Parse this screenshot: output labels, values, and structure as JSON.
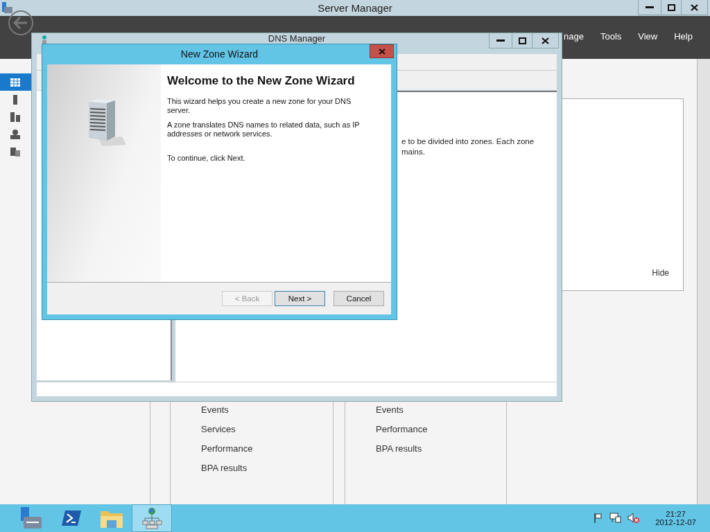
{
  "server_manager": {
    "title": "Server Manager",
    "menu": [
      "nage",
      "Tools",
      "View",
      "Help"
    ],
    "sidebar": [
      {
        "selected": true
      },
      {
        "selected": false
      },
      {
        "selected": false
      },
      {
        "selected": false
      },
      {
        "selected": false
      }
    ],
    "panel": {
      "link": "Hide"
    },
    "tiles": [
      {
        "items": [
          "Events",
          "Services",
          "Performance",
          "BPA results"
        ]
      },
      {
        "items": [
          "Events",
          "Performance",
          "BPA results"
        ]
      }
    ]
  },
  "dns_manager": {
    "title": "DNS Manager",
    "text_lines": [
      "e to be divided into zones. Each zone",
      "mains."
    ]
  },
  "wizard": {
    "title": "New Zone Wizard",
    "heading": "Welcome to the New Zone Wizard",
    "paragraphs": [
      "This wizard helps you create a new zone for your DNS server.",
      "A zone translates DNS names to related data, such as IP addresses or network services.",
      "To continue, click Next."
    ],
    "buttons": [
      {
        "label": "< Back",
        "disabled": true,
        "default": false
      },
      {
        "label": "Next >",
        "disabled": false,
        "default": true
      },
      {
        "label": "Cancel",
        "disabled": false,
        "default": false
      }
    ]
  },
  "taskbar": {
    "apps": [
      {
        "kind": "server-manager",
        "selected": false
      },
      {
        "kind": "powershell",
        "selected": false
      },
      {
        "kind": "explorer",
        "selected": false
      },
      {
        "kind": "dns",
        "selected": true
      }
    ],
    "clock": {
      "time": "21:27",
      "date": "2012-12-07"
    }
  }
}
